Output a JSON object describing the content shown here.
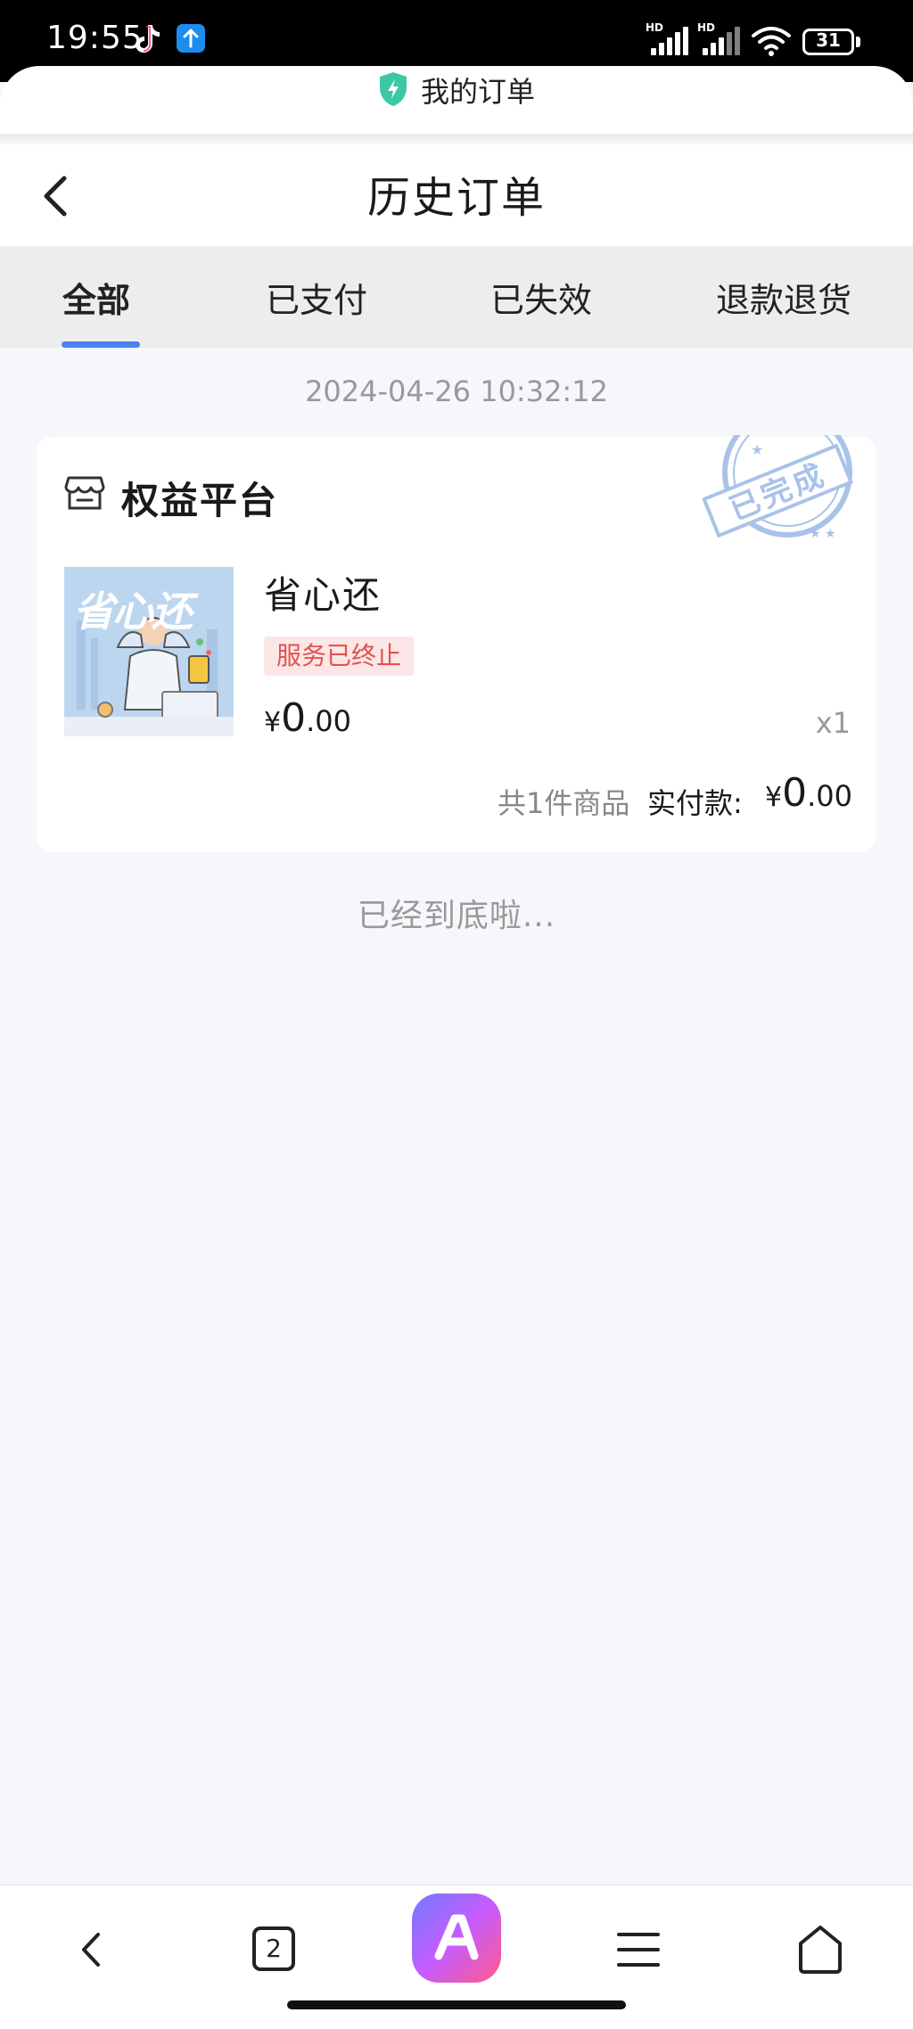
{
  "status_bar": {
    "time": "19:55",
    "signal1_label": "HD",
    "signal2_label": "HD",
    "battery": "31"
  },
  "browser": {
    "mini_title": "我的订单"
  },
  "header": {
    "title": "历史订单"
  },
  "tabs": [
    {
      "label": "全部",
      "active": true
    },
    {
      "label": "已支付",
      "active": false
    },
    {
      "label": "已失效",
      "active": false
    },
    {
      "label": "退款退货",
      "active": false
    }
  ],
  "order": {
    "date": "2024-04-26 10:32:12",
    "store_name": "权益平台",
    "stamp_text": "已完成",
    "product_image_text": "省心还",
    "product_name": "省心还",
    "status_badge": "服务已终止",
    "price_symbol": "¥",
    "price_int": "0",
    "price_dec": ".00",
    "quantity": "x1",
    "item_count": "共1件商品",
    "paid_label": "实付款:",
    "paid_symbol": "¥",
    "paid_int": "0",
    "paid_dec": ".00"
  },
  "end_text": "已经到底啦...",
  "bottom_nav": {
    "tab_count": "2"
  },
  "colors": {
    "accent": "#4a80f0",
    "badge_bg": "#fde6e6",
    "badge_text": "#e0534f",
    "stamp": "#9bb8e6"
  }
}
